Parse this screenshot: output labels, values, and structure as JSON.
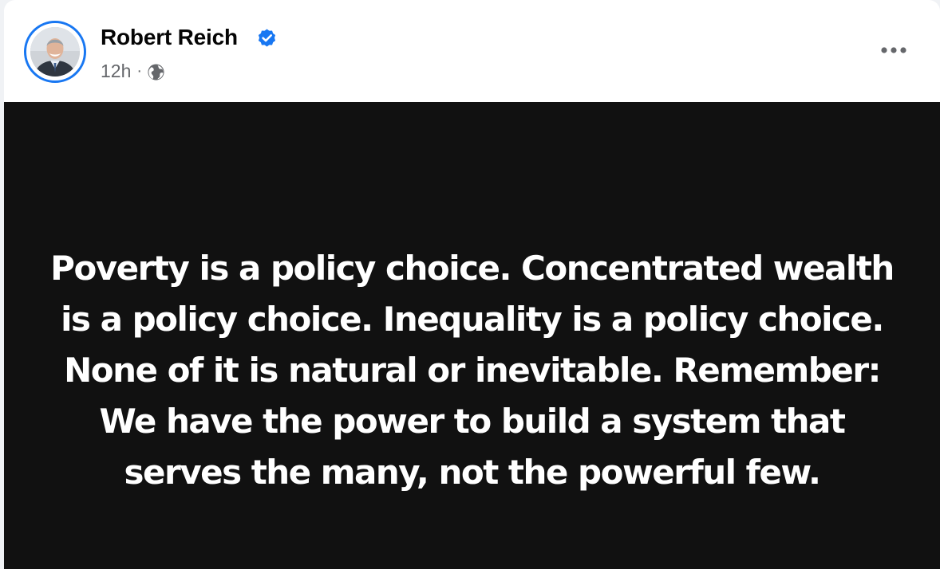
{
  "post": {
    "author": {
      "name": "Robert Reich",
      "verified": true,
      "avatar_icon": "profile-photo"
    },
    "timestamp": "12h",
    "separator": "·",
    "audience_icon": "globe-icon",
    "more_icon": "ellipsis-icon",
    "image_text_lines": [
      "Poverty is a policy choice. Concentrated wealth",
      "is a policy choice. Inequality is a policy choice.",
      "None of it is natural or inevitable. Remember:",
      "We have the power to build a system that",
      "serves the many, not the powerful few."
    ]
  },
  "colors": {
    "accent": "#1877f2",
    "media_background": "#111111",
    "meta_text": "#65676b",
    "name_text": "#050505"
  }
}
